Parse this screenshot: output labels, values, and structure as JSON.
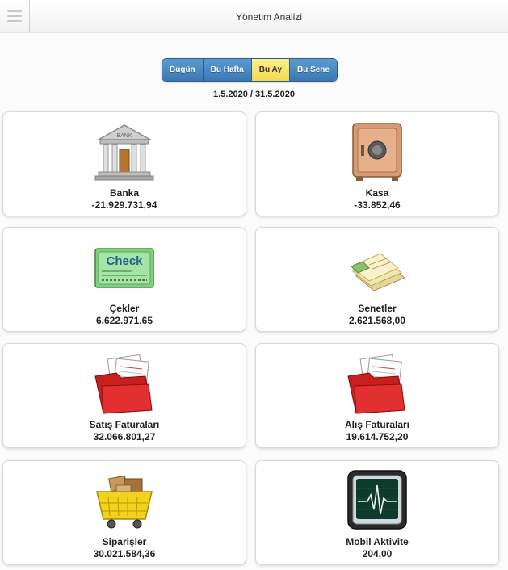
{
  "header": {
    "title": "Yönetim Analizi"
  },
  "period": {
    "buttons": [
      "Bugün",
      "Bu Hafta",
      "Bu Ay",
      "Bu Sene"
    ],
    "active": "Bu Ay"
  },
  "date_range": "1.5.2020 / 31.5.2020",
  "tiles": [
    {
      "label": "Banka",
      "value": "-21.929.731,94",
      "icon": "bank-icon"
    },
    {
      "label": "Kasa",
      "value": "-33.852,46",
      "icon": "safe-icon"
    },
    {
      "label": "Çekler",
      "value": "6.622.971,65",
      "icon": "check-icon"
    },
    {
      "label": "Senetler",
      "value": "2.621.568,00",
      "icon": "promissory-notes-icon"
    },
    {
      "label": "Satış Faturaları",
      "value": "32.066.801,27",
      "icon": "invoice-folder-icon"
    },
    {
      "label": "Alış Faturaları",
      "value": "19.614.752,20",
      "icon": "invoice-folder-icon"
    },
    {
      "label": "Siparişler",
      "value": "30.021.584,36",
      "icon": "shopping-basket-icon"
    },
    {
      "label": "Mobil Aktivite",
      "value": "204,00",
      "icon": "monitor-pulse-icon"
    }
  ],
  "icon_texts": {
    "bank_sign": "BANK",
    "check_word": "Check"
  },
  "colors": {
    "active_button": "#f5d84e",
    "button_blue": "#3b78b3"
  }
}
